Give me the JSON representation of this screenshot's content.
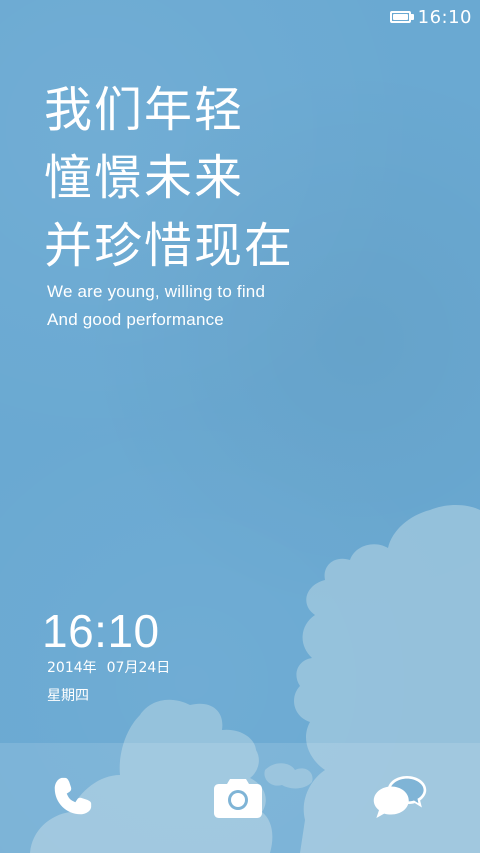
{
  "status_bar": {
    "time": "16:10",
    "battery_icon": "battery-full-icon"
  },
  "poem": {
    "lines": [
      "我们年轻",
      "憧憬未来",
      "并珍惜现在"
    ],
    "english": [
      "We are young, willing to find",
      "And good performance"
    ]
  },
  "clock": {
    "time": "16:10",
    "year": "2014年",
    "month_day": "07月24日",
    "weekday": "星期四"
  },
  "dock": {
    "items": [
      {
        "icon": "phone-icon"
      },
      {
        "icon": "camera-icon"
      },
      {
        "icon": "message-icon"
      }
    ]
  },
  "colors": {
    "background": "#6aa9d2",
    "cloud": "#9cc6dd",
    "text": "#ffffff"
  }
}
